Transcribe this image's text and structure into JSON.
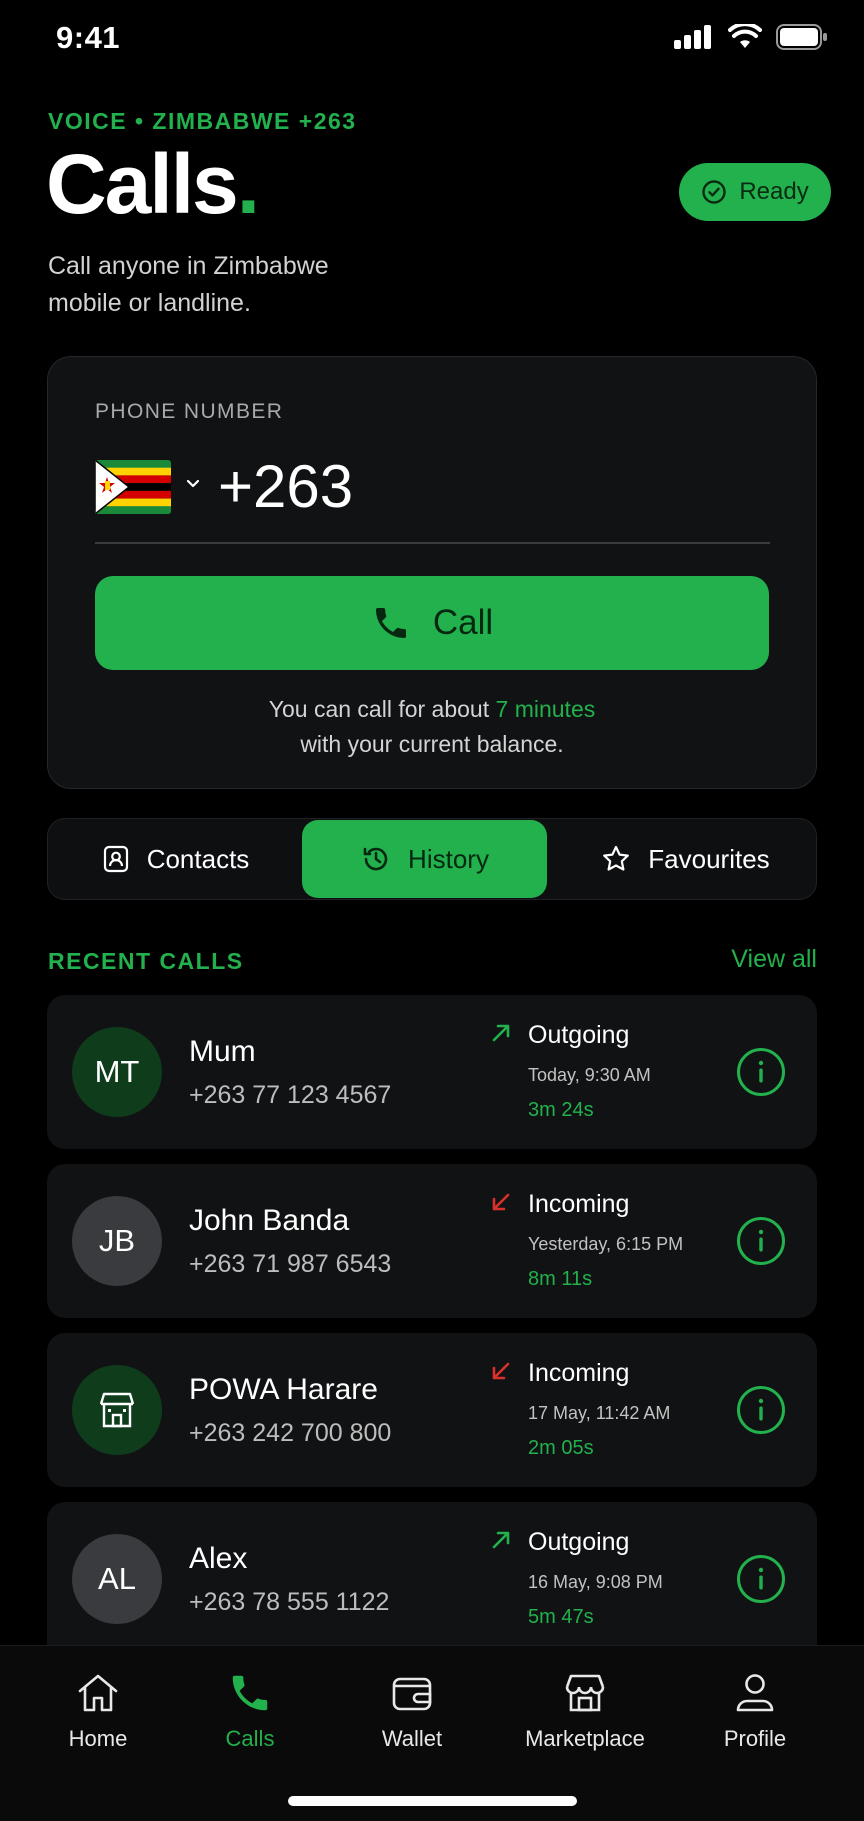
{
  "status_bar": {
    "time": "9:41"
  },
  "header": {
    "eyebrow": "VOICE • ZIMBABWE +263",
    "title": "Calls",
    "title_dot": ".",
    "subtitle": "Call anyone in Zimbabwe mobile or landline.",
    "ready_label": "Ready"
  },
  "dialer": {
    "label": "PHONE NUMBER",
    "country_flag": "zimbabwe-flag",
    "number_value": "+263",
    "call_label": "Call",
    "balance_prefix": "You can call for about",
    "balance_minutes": "7 minutes",
    "balance_suffix": "with your current balance."
  },
  "tabs": [
    {
      "label": "Contacts",
      "icon": "contact-card-icon",
      "active": false
    },
    {
      "label": "History",
      "icon": "history-icon",
      "active": true
    },
    {
      "label": "Favourites",
      "icon": "star-icon",
      "active": false
    }
  ],
  "recent": {
    "label": "RECENT CALLS",
    "view_all": "View all",
    "items": [
      {
        "initials": "MT",
        "name": "Mum",
        "number": "+263 77 123 4567",
        "direction": "Outgoing",
        "time": "Today, 9:30 AM",
        "duration": "3m 24s",
        "avatar_style": "green"
      },
      {
        "initials": "JB",
        "name": "John Banda",
        "number": "+263 71 987 6543",
        "direction": "Incoming",
        "time": "Yesterday, 6:15 PM",
        "duration": "8m 11s",
        "avatar_style": "gray"
      },
      {
        "initials": "",
        "name": "POWA Harare",
        "number": "+263 242 700 800",
        "direction": "Incoming",
        "time": "17 May, 11:42 AM",
        "duration": "2m 05s",
        "avatar_style": "green",
        "avatar_icon": "building-icon"
      },
      {
        "initials": "AL",
        "name": "Alex",
        "number": "+263 78 555 1122",
        "direction": "Outgoing",
        "time": "16 May, 9:08 PM",
        "duration": "5m 47s",
        "avatar_style": "gray"
      }
    ]
  },
  "bottom_nav": [
    {
      "label": "Home",
      "icon": "home-icon",
      "active": false
    },
    {
      "label": "Calls",
      "icon": "phone-icon",
      "active": true
    },
    {
      "label": "Wallet",
      "icon": "wallet-icon",
      "active": false
    },
    {
      "label": "Marketplace",
      "icon": "store-icon",
      "active": false
    },
    {
      "label": "Profile",
      "icon": "profile-icon",
      "active": false
    }
  ],
  "colors": {
    "accent": "#22b14c",
    "background": "#000000",
    "card": "#111214",
    "incoming": "#d8302a"
  }
}
